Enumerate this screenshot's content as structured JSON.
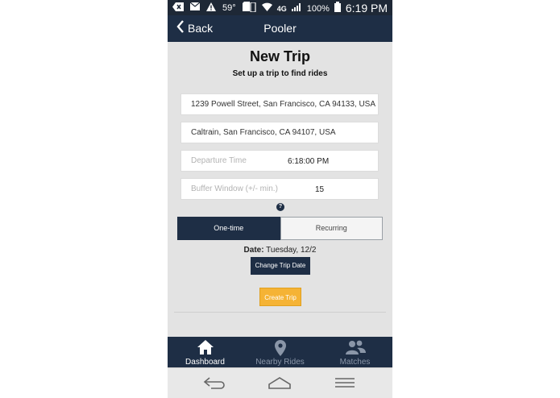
{
  "status_bar": {
    "temperature": "59°",
    "network": "4G",
    "battery": "100%",
    "time": "6:19 PM",
    "icons": [
      "back-arrow-icon",
      "mail-icon",
      "warning-icon",
      "sd-card-icon",
      "vibrate-icon",
      "wifi-icon",
      "signal-icon",
      "battery-icon"
    ]
  },
  "nav": {
    "back_label": "Back",
    "title": "Pooler"
  },
  "form": {
    "title": "New Trip",
    "subtitle": "Set up a trip to find rides",
    "origin": "1239 Powell Street, San Francisco, CA 94133, USA",
    "destination": "Caltrain, San Francisco, CA 94107, USA",
    "departure_placeholder": "Departure Time",
    "departure_value": "6:18:00 PM",
    "buffer_placeholder": "Buffer Window (+/- min.)",
    "buffer_value": "15",
    "help_icon": "?",
    "segment": {
      "one_time": "One-time",
      "recurring": "Recurring",
      "selected": "One-time"
    },
    "date_label": "Date:",
    "date_value": "Tuesday, 12/2",
    "change_date_button": "Change Trip Date",
    "create_button": "Create Trip"
  },
  "tabs": [
    {
      "label": "Dashboard",
      "icon": "home-icon",
      "active": true
    },
    {
      "label": "Nearby Rides",
      "icon": "map-pin-icon",
      "active": false
    },
    {
      "label": "Matches",
      "icon": "people-icon",
      "active": false
    }
  ],
  "colors": {
    "navy": "#1e2e45",
    "accent": "#f5b335",
    "background": "#e3e3e3"
  }
}
